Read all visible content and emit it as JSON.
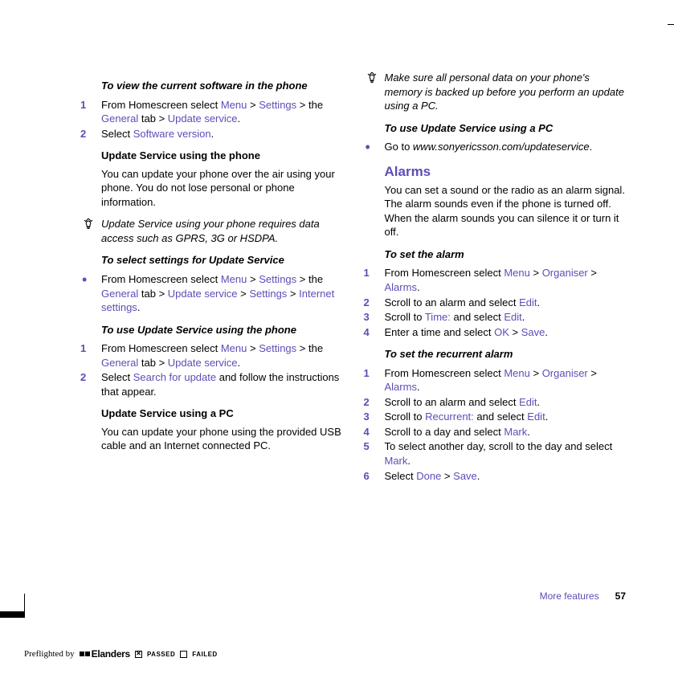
{
  "left": {
    "h1": "To view the current software in the phone",
    "steps1": [
      {
        "pre": "From Homescreen select ",
        "links": [
          "Menu",
          "Settings",
          "General",
          "Update service"
        ],
        "pattern": "menu_settings_general_update"
      },
      {
        "pre": "Select ",
        "links": [
          "Software version"
        ],
        "post": "."
      }
    ],
    "h2": "Update Service using the phone",
    "p2": "You can update your phone over the air using your phone. You do not lose personal or phone information.",
    "tip1": "Update Service using your phone requires data access such as GPRS, 3G or HSDPA.",
    "h3": "To select settings for Update Service",
    "bullet3": {
      "pattern": "menu_settings_general_update_settings_internet"
    },
    "h4": "To use Update Service using the phone",
    "steps4": [
      {
        "pattern": "menu_settings_general_update"
      },
      {
        "pre": "Select ",
        "links": [
          "Search for update"
        ],
        "post": " and follow the instructions that appear."
      }
    ],
    "h5": "Update Service using a PC",
    "p5": "You can update your phone using the provided USB cable and an Internet connected PC."
  },
  "right": {
    "tip1": "Make sure all personal data on your phone's memory is backed up before you perform an update using a PC.",
    "h1": "To use Update Service using a PC",
    "bullet1_pre": "Go to ",
    "bullet1_url": "www.sonyericsson.com/updateservice",
    "section": "Alarms",
    "section_body": "You can set a sound or the radio as an alarm signal. The alarm sounds even if the phone is turned off. When the alarm sounds you can silence it or turn it off.",
    "h2": "To set the alarm",
    "steps2": [
      {
        "pre": "From Homescreen select ",
        "links": [
          "Menu",
          "Organiser",
          "Alarms"
        ],
        "pattern": "menu_organiser_alarms"
      },
      {
        "pre": "Scroll to an alarm and select ",
        "links": [
          "Edit"
        ],
        "post": "."
      },
      {
        "pre": "Scroll to ",
        "links": [
          "Time:"
        ],
        "mid": " and select ",
        "links2": [
          "Edit"
        ],
        "post": "."
      },
      {
        "pre": "Enter a time and select ",
        "links": [
          "OK"
        ],
        "mid": " > ",
        "links2": [
          "Save"
        ],
        "post": "."
      }
    ],
    "h3": "To set the recurrent alarm",
    "steps3": [
      {
        "pre": "From Homescreen select ",
        "links": [
          "Menu",
          "Organiser",
          "Alarms"
        ],
        "pattern": "menu_organiser_alarms"
      },
      {
        "pre": "Scroll to an alarm and select ",
        "links": [
          "Edit"
        ],
        "post": "."
      },
      {
        "pre": "Scroll to ",
        "links": [
          "Recurrent:"
        ],
        "mid": " and select ",
        "links2": [
          "Edit"
        ],
        "post": "."
      },
      {
        "pre": "Scroll to a day and select ",
        "links": [
          "Mark"
        ],
        "post": "."
      },
      {
        "pre": "To select another day, scroll to the day and select ",
        "links": [
          "Mark"
        ],
        "post": "."
      },
      {
        "pre": "Select ",
        "links": [
          "Done"
        ],
        "mid": " > ",
        "links2": [
          "Save"
        ],
        "post": "."
      }
    ]
  },
  "footer": {
    "label": "More features",
    "page": "57"
  },
  "preflight": {
    "by": "Preflighted by",
    "brand": "Elanders",
    "passed": "PASSED",
    "failed": "FAILED"
  },
  "ui": {
    "menu": "Menu",
    "settings": "Settings",
    "the": "the",
    "general": "General",
    "tab": "tab",
    "update_service": "Update service",
    "internet_settings": "Internet settings",
    "organiser": "Organiser",
    "alarms": "Alarms",
    "from_home": "From Homescreen select "
  }
}
